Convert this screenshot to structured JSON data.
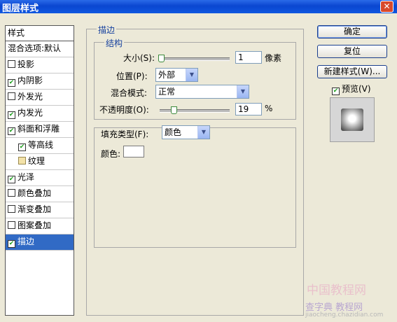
{
  "window": {
    "title": "图层样式",
    "close_glyph": "✕"
  },
  "style_list": {
    "header": "样式",
    "items": [
      {
        "label": "混合选项:默认",
        "checkbox": false
      },
      {
        "label": "投影",
        "checkbox": true,
        "checked": false
      },
      {
        "label": "内阴影",
        "checkbox": true,
        "checked": true
      },
      {
        "label": "外发光",
        "checkbox": true,
        "checked": false
      },
      {
        "label": "内发光",
        "checkbox": true,
        "checked": true
      },
      {
        "label": "斜面和浮雕",
        "checkbox": true,
        "checked": true
      },
      {
        "label": "等高线",
        "checkbox": true,
        "checked": true,
        "sub": true
      },
      {
        "label": "纹理",
        "checkbox": true,
        "checked": false,
        "sub": true,
        "swatch": true
      },
      {
        "label": "光泽",
        "checkbox": true,
        "checked": true
      },
      {
        "label": "颜色叠加",
        "checkbox": true,
        "checked": false
      },
      {
        "label": "渐变叠加",
        "checkbox": true,
        "checked": false
      },
      {
        "label": "图案叠加",
        "checkbox": true,
        "checked": false
      },
      {
        "label": "描边",
        "checkbox": true,
        "checked": true,
        "selected": true
      }
    ]
  },
  "stroke": {
    "section_title": "描边",
    "structure_title": "结构",
    "size_label": "大小(S):",
    "size_value": "1",
    "size_unit": "像素",
    "size_level": 0.0,
    "position_label": "位置(P):",
    "position_value": "外部",
    "blend_label": "混合模式:",
    "blend_value": "正常",
    "opacity_label": "不透明度(O):",
    "opacity_value": "19",
    "opacity_unit": "%",
    "opacity_level": 0.19,
    "fill_type_label": "填充类型(F):",
    "fill_type_value": "颜色",
    "color_label": "颜色:",
    "color_value": "#ffffff"
  },
  "buttons": {
    "ok": "确定",
    "reset": "复位",
    "new_style": "新建样式(W)...",
    "preview_label": "预览(V)",
    "preview_checked": true
  },
  "watermark": {
    "line1": "中国教程网",
    "line2": "查字典 教程网",
    "line3": "jiaocheng.chazidian.com"
  }
}
